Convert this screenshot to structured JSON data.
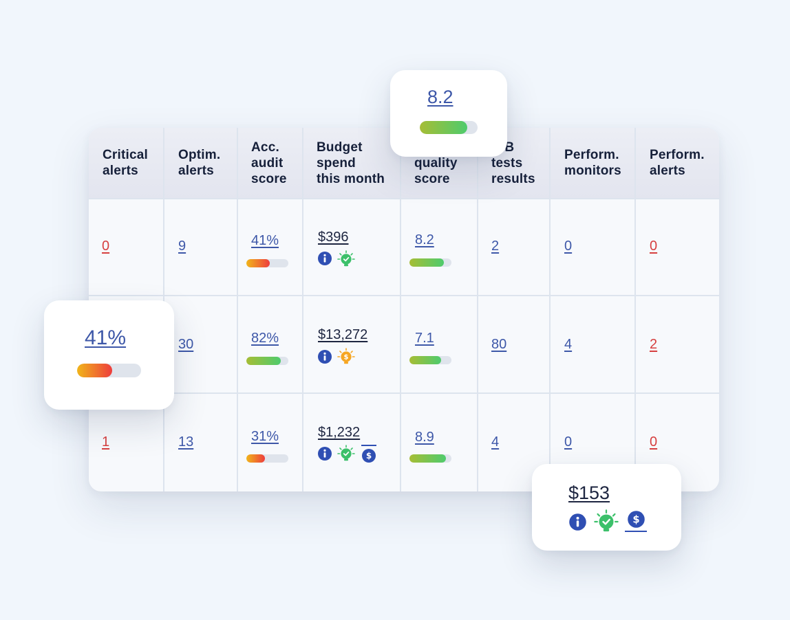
{
  "table": {
    "columns": [
      "Critical\nalerts",
      "Optim.\nalerts",
      "Acc.\naudit\nscore",
      "Budget\nspend\nthis month",
      "Keyword\nquality\nscore",
      "A/B\ntests\nresults",
      "Perform.\nmonitors",
      "Perform.\nalerts"
    ],
    "rows": [
      {
        "critical": "0",
        "optim": "9",
        "audit": "41%",
        "audit_level": 0.55,
        "budget": "$396",
        "budget_icons": [
          "info-icon",
          "lightbulb-check-icon"
        ],
        "quality": "8.2",
        "quality_level": 0.82,
        "tests": "2",
        "monitors": "0",
        "alerts": "0"
      },
      {
        "critical": "",
        "optim": "30",
        "audit": "82%",
        "audit_level": 0.82,
        "budget": "$13,272",
        "budget_icons": [
          "info-icon",
          "lightbulb-dollar-icon"
        ],
        "quality": "7.1",
        "quality_level": 0.75,
        "tests": "80",
        "monitors": "4",
        "alerts": "2"
      },
      {
        "critical": "1",
        "optim": "13",
        "audit": "31%",
        "audit_level": 0.44,
        "budget": "$1,232",
        "budget_icons": [
          "info-icon",
          "lightbulb-check-icon",
          "dollar-coin-icon"
        ],
        "quality": "8.9",
        "quality_level": 0.87,
        "tests": "4",
        "monitors": "0",
        "alerts": "0"
      }
    ]
  },
  "popups": {
    "quality": {
      "value": "8.2",
      "level": 0.82
    },
    "audit": {
      "value": "41%",
      "level": 0.55
    },
    "budget": {
      "value": "$153",
      "icons": [
        "info-icon",
        "lightbulb-check-icon",
        "dollar-coin-icon"
      ]
    }
  },
  "colors": {
    "link": "#3d57a8",
    "alert_red": "#d63f3f",
    "info_blue": "#2f4fb3",
    "bulb_green": "#3cc06a",
    "bulb_orange": "#f6a623"
  }
}
